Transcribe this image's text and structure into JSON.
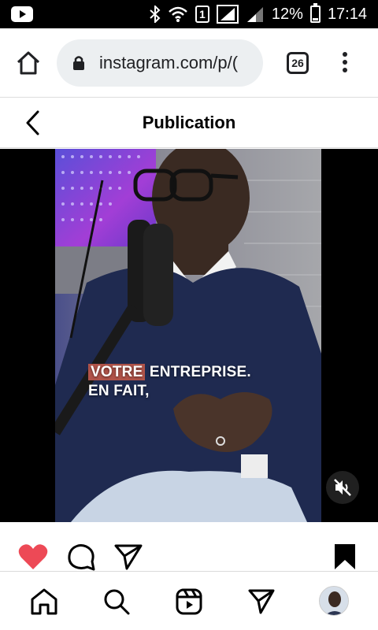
{
  "status_bar": {
    "battery_percent": "12%",
    "time": "17:14",
    "sim_slot": "1",
    "icons": [
      "youtube-icon",
      "bluetooth-icon",
      "wifi-icon",
      "sim-icon",
      "signal-icon",
      "battery-icon"
    ]
  },
  "browser": {
    "url": "instagram.com/p/(",
    "tab_count": "26",
    "icons": [
      "home-icon",
      "lock-icon",
      "more-vert-icon"
    ]
  },
  "header": {
    "title": "Publication"
  },
  "video": {
    "caption_highlight": "VOTRE",
    "caption_line1_rest": " ENTREPRISE.",
    "caption_line2": "EN FAIT,",
    "caption_highlight_color": "#b2544a",
    "muted": true
  },
  "actions": {
    "liked": true,
    "like_color": "#ed4956",
    "icons": [
      "heart-icon",
      "comment-icon",
      "share-icon",
      "bookmark-icon"
    ]
  },
  "bottom_nav": {
    "items": [
      "home-icon",
      "search-icon",
      "reels-icon",
      "direct-icon",
      "avatar"
    ]
  }
}
